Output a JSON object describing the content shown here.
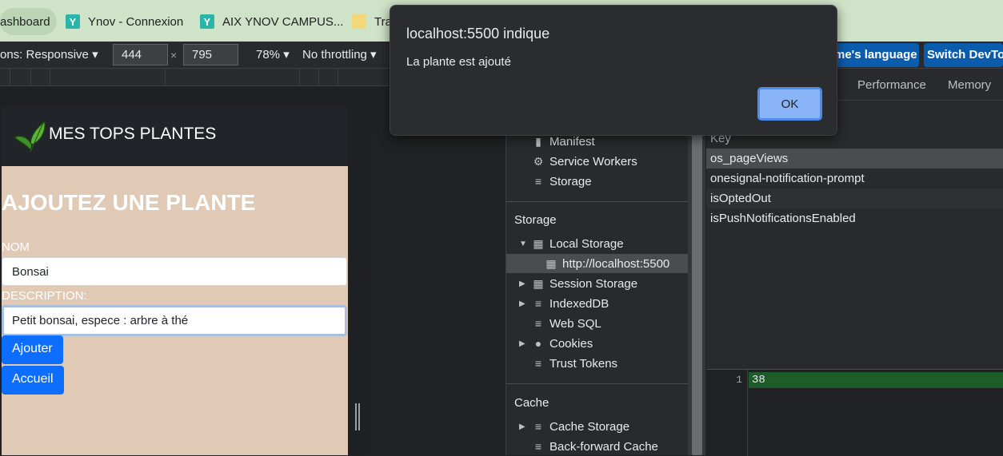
{
  "bookmarks": [
    {
      "label": "ashboard",
      "icon": "page-icon"
    },
    {
      "label": "Ynov - Connexion",
      "icon": "ynov-y-icon"
    },
    {
      "label": "AIX YNOV CAMPUS...",
      "icon": "ynov-y-icon"
    },
    {
      "label": "Tra",
      "icon": "folder-icon"
    }
  ],
  "device_toolbar": {
    "dimensions_label": "ons: Responsive",
    "width": "444",
    "times": "×",
    "height": "795",
    "zoom": "78%",
    "throttling": "No throttling",
    "language_button": "me's language",
    "switch_button": "Switch DevToo"
  },
  "emulated_page": {
    "brand": "MES TOPS PLANTES",
    "heading": "AJOUTEZ UNE PLANTE",
    "name_label": "NOM",
    "name_value": "Bonsai",
    "description_label": "DESCRIPTION:",
    "description_value": "Petit bonsai, espece : arbre à thé",
    "add_button": "Ajouter",
    "home_button": "Accueil"
  },
  "devtools": {
    "tabs": [
      "Performance",
      "Memory"
    ],
    "application_items": [
      "Manifest",
      "Service Workers",
      "Storage"
    ],
    "storage_heading": "Storage",
    "storage_items": [
      {
        "label": "Local Storage",
        "expanded": true
      },
      {
        "label": "http://localhost:5500",
        "selected": true
      },
      {
        "label": "Session Storage"
      },
      {
        "label": "IndexedDB"
      },
      {
        "label": "Web SQL"
      },
      {
        "label": "Cookies"
      },
      {
        "label": "Trust Tokens"
      }
    ],
    "cache_heading": "Cache",
    "cache_items": [
      "Cache Storage",
      "Back-forward Cache"
    ],
    "key_header": "Key",
    "keys": [
      "os_pageViews",
      "onesignal-notification-prompt",
      "isOptedOut",
      "isPushNotificationsEnabled"
    ],
    "value_line_number": "1",
    "value": "38"
  },
  "dialog": {
    "title": "localhost:5500 indique",
    "message": "La plante est ajouté",
    "ok": "OK"
  },
  "colors": {
    "page_background": "#e0c9b5",
    "navbar": "#212529",
    "primary_button": "#0d6efd",
    "dialog_ok": "#8ab4f8"
  }
}
